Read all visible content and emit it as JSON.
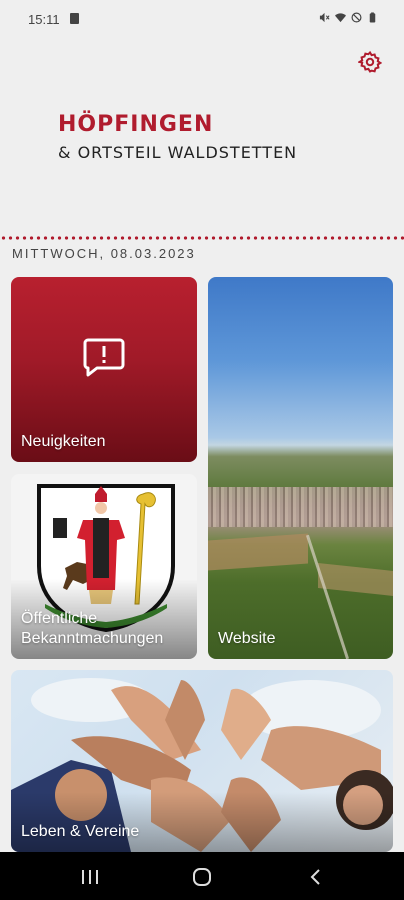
{
  "status_bar": {
    "time": "15:11",
    "left_icon": "clipboard-check-icon",
    "right_icons": [
      "mute-icon",
      "wifi-icon",
      "do-not-disturb-icon",
      "battery-icon"
    ]
  },
  "header": {
    "settings_icon": "gear-icon",
    "logo_title": "HÖPFINGEN",
    "logo_subtitle": "& ORTSTEIL WALDSTETTEN"
  },
  "date": "MITTWOCH, 08.03.2023",
  "tiles": {
    "news": {
      "label": "Neuigkeiten",
      "icon": "alert-message-icon"
    },
    "notices": {
      "label_line1": "Öffentliche",
      "label_line2": "Bekanntmachungen",
      "image": "coat-of-arms"
    },
    "website": {
      "label": "Website",
      "image": "aerial-town-photo"
    },
    "clubs": {
      "label": "Leben & Vereine",
      "image": "joined-hands-photo"
    }
  },
  "nav": {
    "recents_icon": "recents-icon",
    "home_icon": "home-icon",
    "back_icon": "back-icon"
  },
  "colors": {
    "brand_red": "#b01c2e",
    "background": "#efefef",
    "nav_background": "#000000"
  }
}
